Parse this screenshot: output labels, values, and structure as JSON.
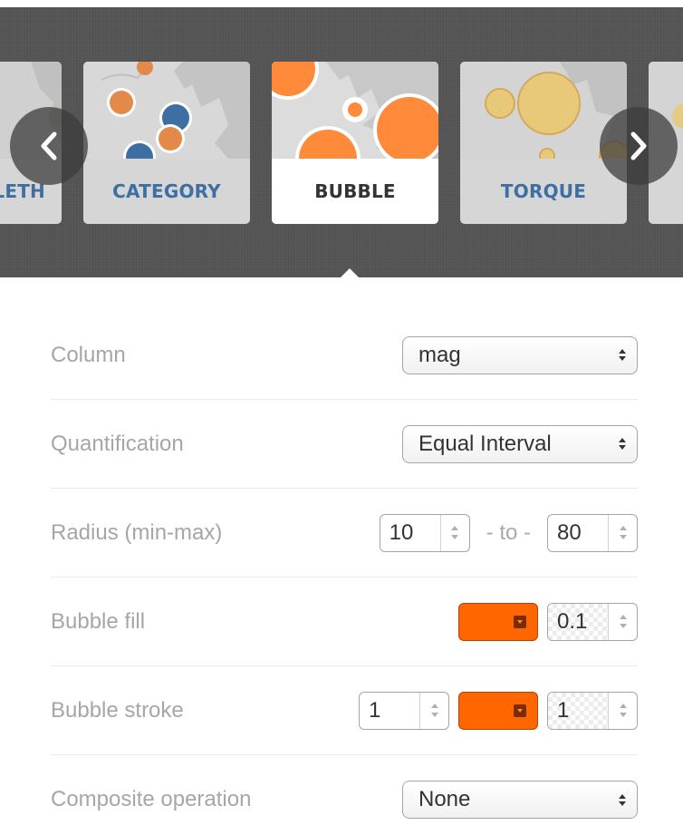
{
  "carousel": {
    "cards": [
      {
        "label": "LETH"
      },
      {
        "label": "CATEGORY"
      },
      {
        "label": "BUBBLE"
      },
      {
        "label": "TORQUE"
      }
    ],
    "selected": "BUBBLE",
    "prev_icon": "chevron-left-icon",
    "next_icon": "chevron-right-icon"
  },
  "form": {
    "column": {
      "label": "Column",
      "value": "mag"
    },
    "quantification": {
      "label": "Quantification",
      "value": "Equal Interval"
    },
    "radius": {
      "label": "Radius (min-max)",
      "min": "10",
      "separator": "- to -",
      "max": "80"
    },
    "bubble_fill": {
      "label": "Bubble fill",
      "color": "#ff6600",
      "opacity": "0.1"
    },
    "bubble_stroke": {
      "label": "Bubble stroke",
      "width": "1",
      "color": "#ff6600",
      "opacity": "1"
    },
    "composite": {
      "label": "Composite operation",
      "value": "None"
    }
  },
  "colors": {
    "accent_orange": "#ff6600",
    "label_blue": "#3e6fa2",
    "panel_dark": "#555555"
  }
}
